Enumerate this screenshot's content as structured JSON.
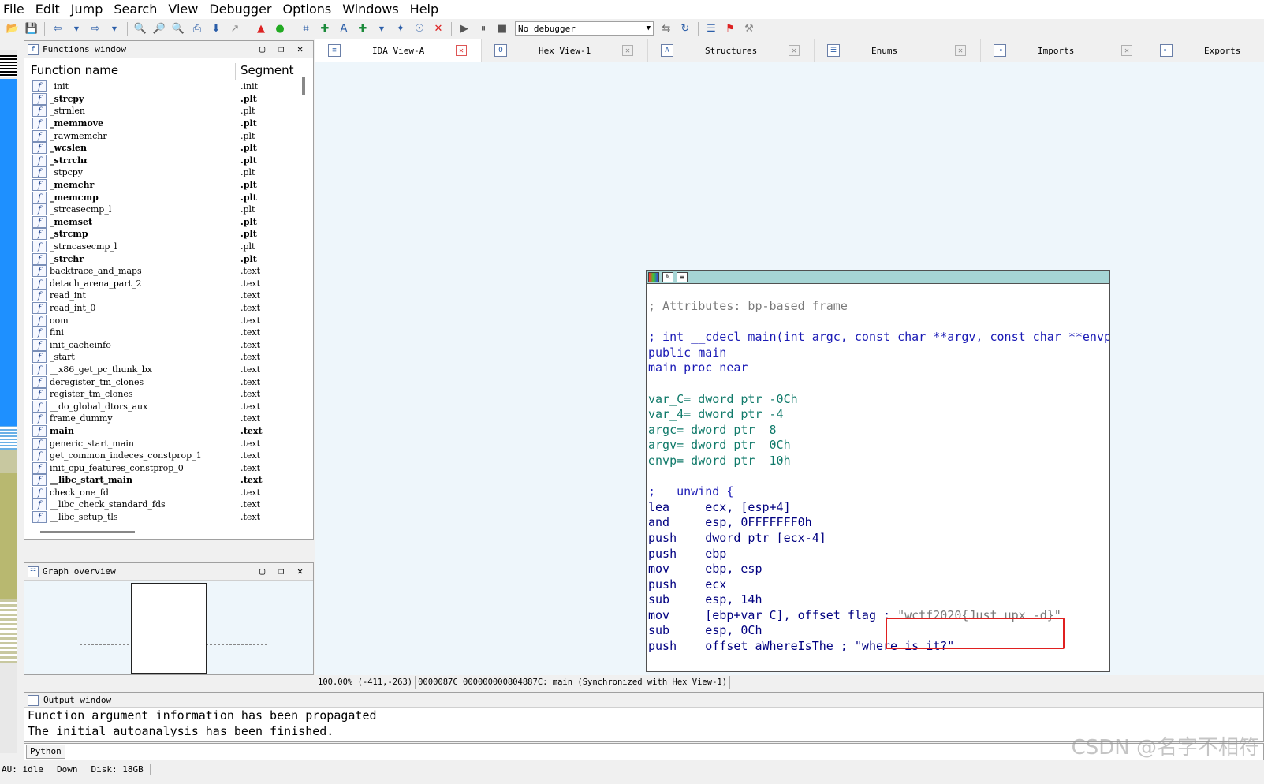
{
  "menu": [
    "File",
    "Edit",
    "Jump",
    "Search",
    "View",
    "Debugger",
    "Options",
    "Windows",
    "Help"
  ],
  "toolbar": {
    "debugger_select": "No debugger"
  },
  "functions_window": {
    "title": "Functions window",
    "col_name": "Function name",
    "col_segment": "Segment",
    "rows": [
      {
        "name": "_init",
        "seg": ".init",
        "bold": false
      },
      {
        "name": "_strcpy",
        "seg": ".plt",
        "bold": true
      },
      {
        "name": "_strnlen",
        "seg": ".plt",
        "bold": false
      },
      {
        "name": "_memmove",
        "seg": ".plt",
        "bold": true
      },
      {
        "name": "_rawmemchr",
        "seg": ".plt",
        "bold": false
      },
      {
        "name": "_wcslen",
        "seg": ".plt",
        "bold": true
      },
      {
        "name": "_strrchr",
        "seg": ".plt",
        "bold": true
      },
      {
        "name": "_stpcpy",
        "seg": ".plt",
        "bold": false
      },
      {
        "name": "_memchr",
        "seg": ".plt",
        "bold": true
      },
      {
        "name": "_memcmp",
        "seg": ".plt",
        "bold": true
      },
      {
        "name": "_strcasecmp_l",
        "seg": ".plt",
        "bold": false
      },
      {
        "name": "_memset",
        "seg": ".plt",
        "bold": true
      },
      {
        "name": "_strcmp",
        "seg": ".plt",
        "bold": true
      },
      {
        "name": "_strncasecmp_l",
        "seg": ".plt",
        "bold": false
      },
      {
        "name": "_strchr",
        "seg": ".plt",
        "bold": true
      },
      {
        "name": "backtrace_and_maps",
        "seg": ".text",
        "bold": false
      },
      {
        "name": "detach_arena_part_2",
        "seg": ".text",
        "bold": false
      },
      {
        "name": "read_int",
        "seg": ".text",
        "bold": false
      },
      {
        "name": "read_int_0",
        "seg": ".text",
        "bold": false
      },
      {
        "name": "oom",
        "seg": ".text",
        "bold": false
      },
      {
        "name": "fini",
        "seg": ".text",
        "bold": false
      },
      {
        "name": "init_cacheinfo",
        "seg": ".text",
        "bold": false
      },
      {
        "name": "_start",
        "seg": ".text",
        "bold": false
      },
      {
        "name": "__x86_get_pc_thunk_bx",
        "seg": ".text",
        "bold": false
      },
      {
        "name": "deregister_tm_clones",
        "seg": ".text",
        "bold": false
      },
      {
        "name": "register_tm_clones",
        "seg": ".text",
        "bold": false
      },
      {
        "name": "__do_global_dtors_aux",
        "seg": ".text",
        "bold": false
      },
      {
        "name": "frame_dummy",
        "seg": ".text",
        "bold": false
      },
      {
        "name": "main",
        "seg": ".text",
        "bold": true
      },
      {
        "name": "generic_start_main",
        "seg": ".text",
        "bold": false
      },
      {
        "name": "get_common_indeces_constprop_1",
        "seg": ".text",
        "bold": false
      },
      {
        "name": "init_cpu_features_constprop_0",
        "seg": ".text",
        "bold": false
      },
      {
        "name": "__libc_start_main",
        "seg": ".text",
        "bold": true
      },
      {
        "name": "check_one_fd",
        "seg": ".text",
        "bold": false
      },
      {
        "name": "__libc_check_standard_fds",
        "seg": ".text",
        "bold": false
      },
      {
        "name": "__libc_setup_tls",
        "seg": ".text",
        "bold": false
      }
    ]
  },
  "graph_overview": {
    "title": "Graph overview"
  },
  "tabs": [
    {
      "label": "IDA View-A",
      "active": true
    },
    {
      "label": "Hex View-1",
      "active": false
    },
    {
      "label": "Structures",
      "active": false
    },
    {
      "label": "Enums",
      "active": false
    },
    {
      "label": "Imports",
      "active": false
    },
    {
      "label": "Exports",
      "active": false
    }
  ],
  "disasm": {
    "l1": "; Attributes: bp-based frame",
    "l2": "; int __cdecl main(int argc, const char **argv, const char **envp)",
    "l3": "public main",
    "l4": "main proc near",
    "l5": "var_C= dword ptr -0Ch",
    "l6": "var_4= dword ptr -4",
    "l7": "argc= dword ptr  8",
    "l8": "argv= dword ptr  0Ch",
    "l9": "envp= dword ptr  10h",
    "l10": "; __unwind {",
    "l11": "lea     ecx, [esp+4]",
    "l12": "and     esp, 0FFFFFFF0h",
    "l13": "push    dword ptr [ecx-4]",
    "l14": "push    ebp",
    "l15": "mov     ebp, esp",
    "l16": "push    ecx",
    "l17": "sub     esp, 14h",
    "l18": "mov     [ebp+var_C], offset flag ;",
    "l18_str": "\"wctf2020{Just_upx_-d}\"",
    "l19": "sub     esp, 0Ch",
    "l20": "push    offset aWhereIsThe ; \"where is it?\""
  },
  "view_status": {
    "zoom": "100.00% (-411,-263)",
    "addr": "0000087C 000000000804887C: main (Synchronized with Hex View-1)"
  },
  "output": {
    "title": "Output window",
    "lines": [
      "Function argument information has been propagated",
      "The initial autoanalysis has been finished."
    ],
    "python_btn": "Python"
  },
  "statusbar": {
    "au": "AU:  idle",
    "dir": "Down",
    "disk": "Disk: 18GB"
  },
  "watermark": "CSDN @名字不相符"
}
